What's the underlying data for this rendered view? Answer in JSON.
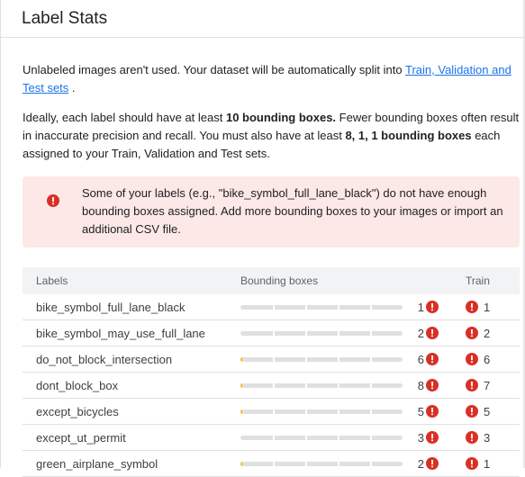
{
  "title": "Label Stats",
  "intro": {
    "text": "Unlabeled images aren't used. Your dataset will be automatically split into ",
    "link": "Train, Validation and Test sets",
    "suffix": " ."
  },
  "requirement": {
    "t1": "Ideally, each label should have at least ",
    "b1": "10 bounding boxes.",
    "t2": " Fewer bounding boxes often result in inaccurate precision and recall. You must also have at least ",
    "b2": "8, 1, 1 bounding boxes",
    "t3": " each assigned to your Train, Validation and Test sets."
  },
  "alert": {
    "text": "Some of your labels (e.g., \"bike_symbol_full_lane_black\") do not have enough bounding boxes assigned. Add more bounding boxes to your images or import an additional CSV file."
  },
  "table": {
    "headers": {
      "labels": "Labels",
      "bounding_boxes": "Bounding boxes",
      "train": "Train"
    },
    "rows": [
      {
        "label": "bike_symbol_full_lane_black",
        "boxes": "1",
        "train": "1",
        "fill": 0.0
      },
      {
        "label": "bike_symbol_may_use_full_lane",
        "boxes": "2",
        "train": "2",
        "fill": 0.0
      },
      {
        "label": "do_not_block_intersection",
        "boxes": "6",
        "train": "6",
        "fill": 0.01
      },
      {
        "label": "dont_block_box",
        "boxes": "8",
        "train": "7",
        "fill": 0.01
      },
      {
        "label": "except_bicycles",
        "boxes": "5",
        "train": "5",
        "fill": 0.01
      },
      {
        "label": "except_ut_permit",
        "boxes": "3",
        "train": "3",
        "fill": 0.0
      },
      {
        "label": "green_airplane_symbol",
        "boxes": "2",
        "train": "1",
        "fill": 0.01
      }
    ]
  },
  "colors": {
    "error": "#d93025",
    "link": "#1a73e8",
    "alert_bg": "#fce8e6",
    "bar_track": "#e0e0e0",
    "bar_fill": "#fbbc04"
  },
  "icons": {
    "error": "error-icon"
  }
}
